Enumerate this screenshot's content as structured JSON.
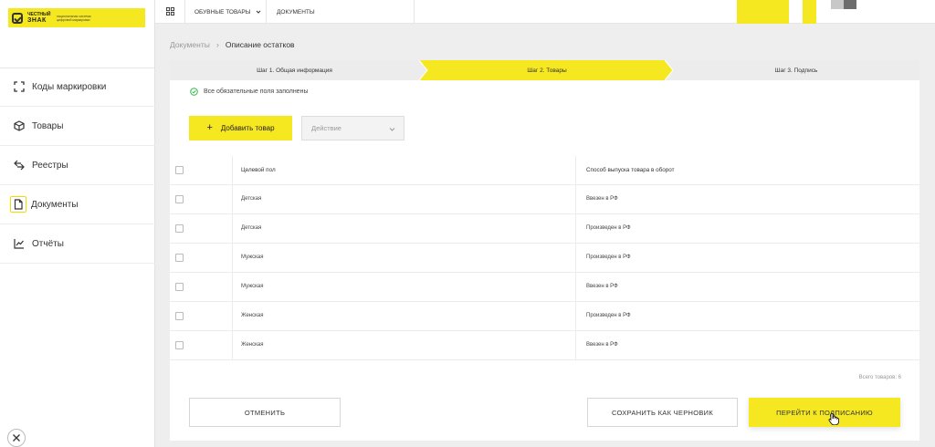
{
  "logo": {
    "line1": "ЧЕСТНЫЙ",
    "line2": "ЗНАК",
    "subtitle": "национальная система цифровой маркировки"
  },
  "sidebar": {
    "items": [
      {
        "label": "Коды маркировки",
        "icon": "scan-icon"
      },
      {
        "label": "Товары",
        "icon": "box-icon"
      },
      {
        "label": "Реестры",
        "icon": "transfer-icon"
      },
      {
        "label": "Документы",
        "icon": "document-icon"
      },
      {
        "label": "Отчёты",
        "icon": "chart-icon"
      }
    ],
    "active_index": 3
  },
  "topbar": {
    "menu_products": "ОБУВНЫЕ ТОВАРЫ",
    "menu_documents": "ДОКУМЕНТЫ"
  },
  "breadcrumb": {
    "parent": "Документы",
    "current": "Описание остатков"
  },
  "steps": [
    {
      "label": "Шаг 1. Общая информация",
      "active": false
    },
    {
      "label": "Шаг 2. Товары",
      "active": true
    },
    {
      "label": "Шаг 3. Подпись",
      "active": false
    }
  ],
  "status": {
    "text": "Все обязательные поля заполнены"
  },
  "toolbar": {
    "add_label": "Добавить товар",
    "action_placeholder": "Действие"
  },
  "table": {
    "headers": [
      "Целевой пол",
      "Способ выпуска товара в оборот"
    ],
    "rows": [
      [
        "Детская",
        "Ввезен в РФ"
      ],
      [
        "Детская",
        "Произведен в РФ"
      ],
      [
        "Мужская",
        "Произведен в РФ"
      ],
      [
        "Мужская",
        "Ввезен в РФ"
      ],
      [
        "Женская",
        "Произведен в РФ"
      ],
      [
        "Женская",
        "Ввезен в РФ"
      ]
    ],
    "total": "Всего товаров: 6"
  },
  "buttons": {
    "cancel": "ОТМЕНИТЬ",
    "draft": "СОХРАНИТЬ КАК ЧЕРНОВИК",
    "sign": "ПЕРЕЙТИ К ПОДПИСАНИЮ"
  },
  "colors": {
    "accent": "#f5e820",
    "success": "#2fb345"
  }
}
